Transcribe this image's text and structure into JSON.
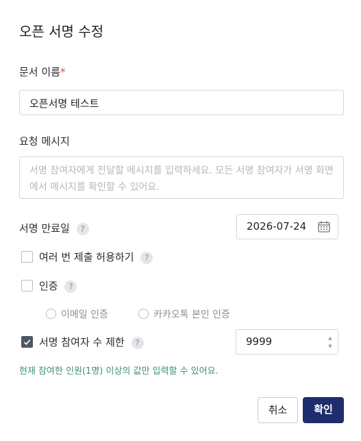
{
  "dialog": {
    "title": "오픈 서명 수정",
    "doc_name": {
      "label": "문서 이름",
      "required_mark": "*",
      "value": "오픈서명 테스트"
    },
    "message": {
      "label": "요청 메시지",
      "placeholder": "서명 참여자에게 전달할 메시지를 입력하세요. 모든 서명 참여자가 서명 화면에서 메시지를 확인할 수 있어요."
    },
    "expiry": {
      "label": "서명 만료일",
      "value": "2026-07-24"
    },
    "allow_multiple": {
      "label": "여러 번 제출 허용하기",
      "checked": false
    },
    "auth": {
      "label": "인증",
      "checked": false,
      "options": [
        "이메일 인증",
        "카카오톡 본인 인증"
      ]
    },
    "limit": {
      "label": "서명 참여자 수 제한",
      "checked": true,
      "value": "9999"
    },
    "hint": "현재 참여한 인원(1명) 이상의 값만 입력할 수 있어요.",
    "help_glyph": "?",
    "buttons": {
      "cancel": "취소",
      "confirm": "확인"
    },
    "colors": {
      "primary": "#1d2d6e",
      "hint": "#3f8f7c",
      "required": "#e0483a",
      "checkbox_checked": "#4d5866"
    }
  }
}
